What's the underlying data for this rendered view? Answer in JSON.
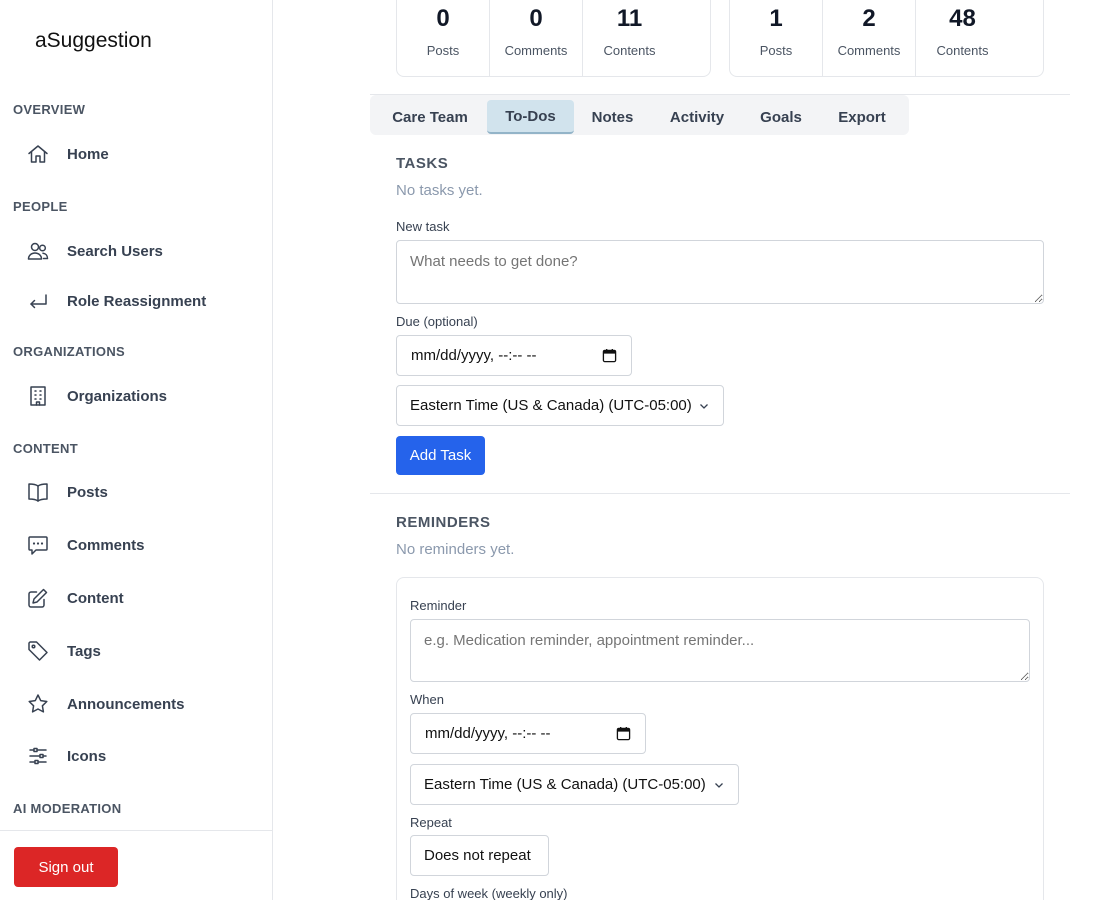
{
  "brand": "aSuggestion",
  "sidebar": {
    "sections": [
      "OVERVIEW",
      "PEOPLE",
      "ORGANIZATIONS",
      "CONTENT",
      "AI MODERATION"
    ],
    "items": [
      {
        "label": "Home",
        "icon": "home-icon"
      },
      {
        "label": "Search Users",
        "icon": "users-icon"
      },
      {
        "label": "Role Reassignment",
        "icon": "return-arrow-icon"
      },
      {
        "label": "Organizations",
        "icon": "building-icon"
      },
      {
        "label": "Posts",
        "icon": "book-icon"
      },
      {
        "label": "Comments",
        "icon": "chat-bubble-icon"
      },
      {
        "label": "Content",
        "icon": "pencil-square-icon"
      },
      {
        "label": "Tags",
        "icon": "tag-icon"
      },
      {
        "label": "Announcements",
        "icon": "star-icon"
      },
      {
        "label": "Icons",
        "icon": "sliders-icon"
      }
    ],
    "signout": "Sign out"
  },
  "stats": {
    "left": [
      {
        "value": "0",
        "label": "Posts"
      },
      {
        "value": "0",
        "label": "Comments"
      },
      {
        "value": "11",
        "label": "Contents"
      }
    ],
    "right": [
      {
        "value": "1",
        "label": "Posts"
      },
      {
        "value": "2",
        "label": "Comments"
      },
      {
        "value": "48",
        "label": "Contents"
      }
    ]
  },
  "tabs": [
    "Care Team",
    "To-Dos",
    "Notes",
    "Activity",
    "Goals",
    "Export"
  ],
  "active_tab": "To-Dos",
  "tasks": {
    "heading": "TASKS",
    "empty": "No tasks yet.",
    "new_label": "New task",
    "new_placeholder": "What needs to get done?",
    "due_label": "Due (optional)",
    "due_value": "mm/dd/yyyy, --:-- --",
    "timezone": "Eastern Time (US & Canada) (UTC-05:00)",
    "add_button": "Add Task"
  },
  "reminders": {
    "heading": "REMINDERS",
    "empty": "No reminders yet.",
    "reminder_label": "Reminder",
    "reminder_placeholder": "e.g. Medication reminder, appointment reminder...",
    "when_label": "When",
    "when_value": "mm/dd/yyyy, --:-- --",
    "timezone": "Eastern Time (US & Canada) (UTC-05:00)",
    "repeat_label": "Repeat",
    "repeat_value": "Does not repeat",
    "days_label": "Days of week (weekly only)"
  },
  "colors": {
    "primary": "#2563eb",
    "danger": "#dc2626",
    "active_tab": "#d1e3ed"
  }
}
